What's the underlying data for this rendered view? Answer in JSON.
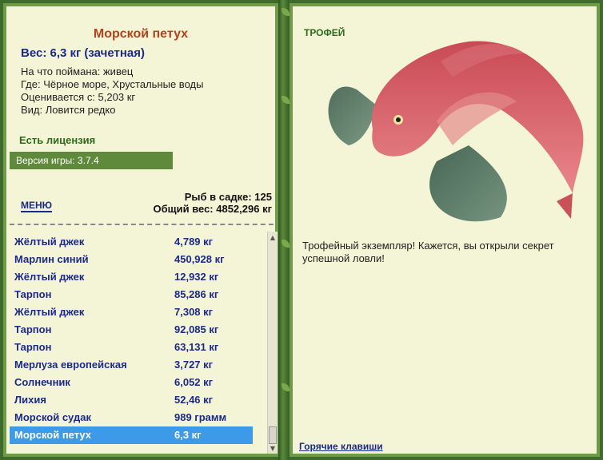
{
  "fish": {
    "name": "Морской петух",
    "weight_line": "Вес: 6,3 кг (зачетная)",
    "caught_with": "На что поймана: живец",
    "location": "Где: Чёрное море, Хрустальные воды",
    "value": "Оценивается с: 5,203 кг",
    "rarity": "Вид: Ловится редко"
  },
  "license": "Есть лицензия",
  "version": "Версия игры: 3.7.4",
  "menu": "МЕНЮ",
  "stats": {
    "fish_count": "Рыб в садке: 125",
    "total_weight": "Общий вес: 4852,296 кг"
  },
  "catch_list": [
    {
      "name": "Жёлтый джек",
      "weight": "4,789 кг"
    },
    {
      "name": "Марлин синий",
      "weight": "450,928 кг"
    },
    {
      "name": "Жёлтый джек",
      "weight": "12,932 кг"
    },
    {
      "name": "Тарпон",
      "weight": "85,286 кг"
    },
    {
      "name": "Жёлтый джек",
      "weight": "7,308 кг"
    },
    {
      "name": "Тарпон",
      "weight": "92,085 кг"
    },
    {
      "name": "Тарпон",
      "weight": "63,131 кг"
    },
    {
      "name": "Мерлуза европейская",
      "weight": "3,727 кг"
    },
    {
      "name": "Солнечник",
      "weight": "6,052 кг"
    },
    {
      "name": "Лихия",
      "weight": "52,46 кг"
    },
    {
      "name": "Морской судак",
      "weight": "989 грамм"
    },
    {
      "name": "Морской петух",
      "weight": "6,3 кг",
      "selected": true
    }
  ],
  "trophy": {
    "label": "ТРОФЕЙ",
    "description": "Трофейный экземпляр! Кажется, вы открыли секрет успешной ловли!"
  },
  "hotkeys": "Горячие клавиши",
  "icons": {
    "scroll_up": "triangle-up",
    "scroll_down": "triangle-down"
  },
  "colors": {
    "panel_bg": "#f4f4d6",
    "frame": "#6f9b49",
    "accent_blue": "#1b2a8a",
    "title_red": "#b5421b",
    "selected": "#3d9ae8"
  }
}
